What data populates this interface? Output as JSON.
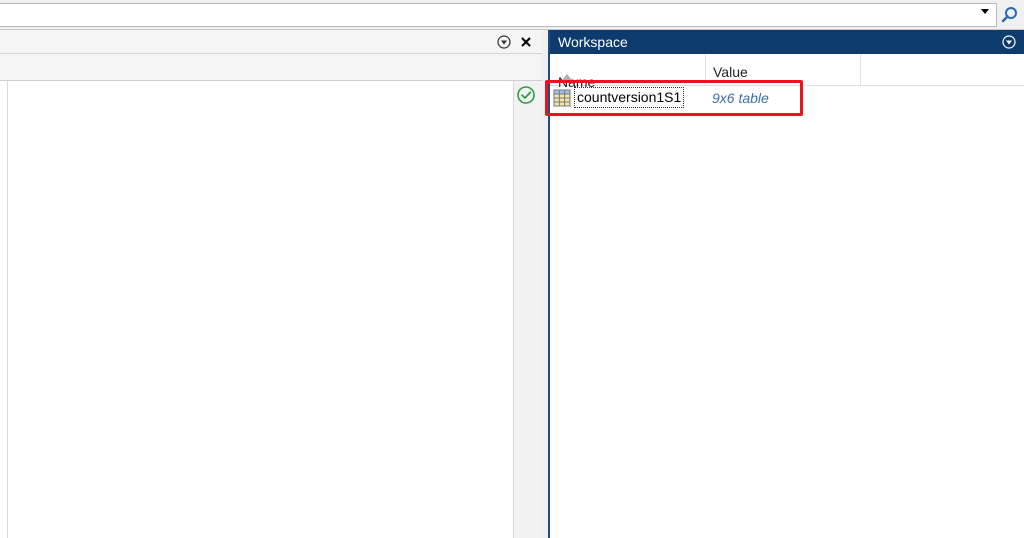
{
  "workspace": {
    "title": "Workspace",
    "columns": {
      "name": "Name",
      "value": "Value"
    },
    "variables": [
      {
        "name": "countversion1S1",
        "value": "9x6 table",
        "icon": "table-icon"
      }
    ]
  },
  "colors": {
    "workspace_title_bg": "#0d3b6e",
    "value_text": "#3b6ea8",
    "highlight_border": "#e81420",
    "check_green": "#2e9e3e"
  },
  "icons": {
    "search": "search-icon",
    "dropdown": "chevron-down-icon",
    "panel_menu": "panel-menu-icon",
    "close": "close-icon",
    "status": "check-circle-icon"
  }
}
